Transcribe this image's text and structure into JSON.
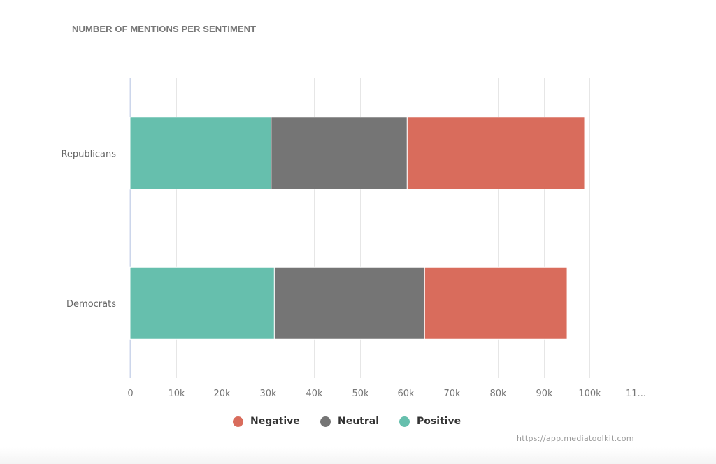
{
  "title": "NUMBER OF MENTIONS PER SENTIMENT",
  "credits": "https://app.mediatoolkit.com",
  "chart_data": {
    "type": "bar",
    "orientation": "horizontal",
    "stacked": true,
    "title": "NUMBER OF MENTIONS PER SENTIMENT",
    "categories": [
      "Republicans",
      "Democrats"
    ],
    "series": [
      {
        "name": "Positive",
        "color": "#66bfad",
        "values": [
          30700,
          31400
        ]
      },
      {
        "name": "Neutral",
        "color": "#757575",
        "values": [
          29600,
          32700
        ]
      },
      {
        "name": "Negative",
        "color": "#d96c5c",
        "values": [
          38600,
          31000
        ]
      }
    ],
    "xlabel": "",
    "ylabel": "",
    "xlim": [
      0,
      110000
    ],
    "x_ticks": [
      0,
      10000,
      20000,
      30000,
      40000,
      50000,
      60000,
      70000,
      80000,
      90000,
      100000,
      110000
    ],
    "x_tick_labels": [
      "0",
      "10k",
      "20k",
      "30k",
      "40k",
      "50k",
      "60k",
      "70k",
      "80k",
      "90k",
      "100k",
      "11..."
    ],
    "grid": true,
    "legend": {
      "position": "bottom-center",
      "items": [
        {
          "name": "Negative",
          "color": "#d96c5c"
        },
        {
          "name": "Neutral",
          "color": "#757575"
        },
        {
          "name": "Positive",
          "color": "#66bfad"
        }
      ]
    }
  }
}
